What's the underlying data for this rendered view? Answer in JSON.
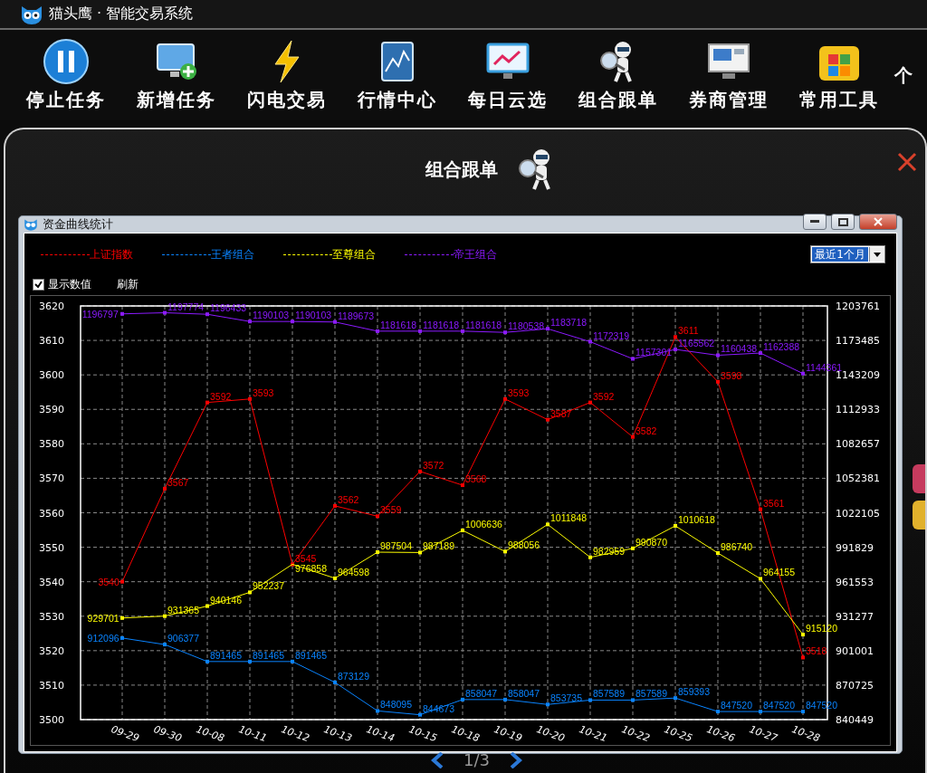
{
  "app": {
    "title": "猫头鹰 · 智能交易系统"
  },
  "toolbar": [
    {
      "label": "停止任务",
      "kind": "pause"
    },
    {
      "label": "新增任务",
      "kind": "add"
    },
    {
      "label": "闪电交易",
      "kind": "bolt"
    },
    {
      "label": "行情中心",
      "kind": "chart"
    },
    {
      "label": "每日云选",
      "kind": "screen"
    },
    {
      "label": "组合跟单",
      "kind": "magnifier"
    },
    {
      "label": "券商管理",
      "kind": "window"
    },
    {
      "label": "常用工具",
      "kind": "apps"
    },
    {
      "label": "个",
      "kind": "none"
    }
  ],
  "panel": {
    "title": "组合跟单"
  },
  "dialog": {
    "title": "资金曲线统计",
    "period": {
      "value": "最近1个月"
    },
    "show_values": {
      "label": "显示数值",
      "checked": true
    },
    "refresh": "刷新",
    "chart_data": {
      "type": "line",
      "categories": [
        "09-29",
        "09-30",
        "10-08",
        "10-11",
        "10-12",
        "10-13",
        "10-14",
        "10-15",
        "10-18",
        "10-19",
        "10-20",
        "10-21",
        "10-22",
        "10-25",
        "10-26",
        "10-27",
        "10-28"
      ],
      "ylim": [
        3500,
        3620
      ],
      "yticks": [
        3500,
        3510,
        3520,
        3530,
        3540,
        3550,
        3560,
        3570,
        3580,
        3590,
        3600,
        3610,
        3620
      ],
      "y2lim": [
        840449,
        1203761
      ],
      "y2ticks": [
        840449,
        870725,
        901001,
        931277,
        961553,
        991829,
        1022105,
        1052381,
        1082657,
        1112933,
        1143209,
        1173485,
        1203761
      ],
      "data_labels": true,
      "grid": true,
      "series": [
        {
          "name": "上证指数",
          "color": "#ff0000",
          "marker": "square",
          "values": [
            3540,
            3567,
            3592,
            3593,
            3545,
            3562,
            3559,
            3572,
            3568,
            3593,
            3587,
            3592,
            3582,
            3611,
            3598,
            3561,
            3518
          ]
        },
        {
          "name": "王者组合",
          "color": "#0a84ff",
          "marker": "square",
          "axis": "y2",
          "values": [
            912096,
            906377,
            891465,
            891465,
            891465,
            873129,
            848095,
            844673,
            858047,
            858047,
            853735,
            857589,
            857589,
            859393,
            847520,
            847520,
            847520
          ]
        },
        {
          "name": "至尊组合",
          "color": "#ffff00",
          "marker": "square",
          "axis": "y2",
          "values": [
            929701,
            931365,
            940146,
            952237,
            976858,
            964598,
            987504,
            987189,
            1006636,
            988056,
            1011848,
            982959,
            990870,
            1010618,
            986740,
            964155,
            915120
          ]
        },
        {
          "name": "帝王组合",
          "color": "#8c1aff",
          "marker": "square",
          "axis": "y2",
          "values": [
            1196797,
            1197774,
            1196433,
            1190103,
            1190103,
            1189673,
            1181618,
            1181618,
            1181618,
            1180538,
            1183718,
            1172319,
            1157301,
            1165562,
            1160438,
            1162388,
            1144361
          ]
        }
      ]
    }
  },
  "pager": {
    "text": "1/3"
  }
}
